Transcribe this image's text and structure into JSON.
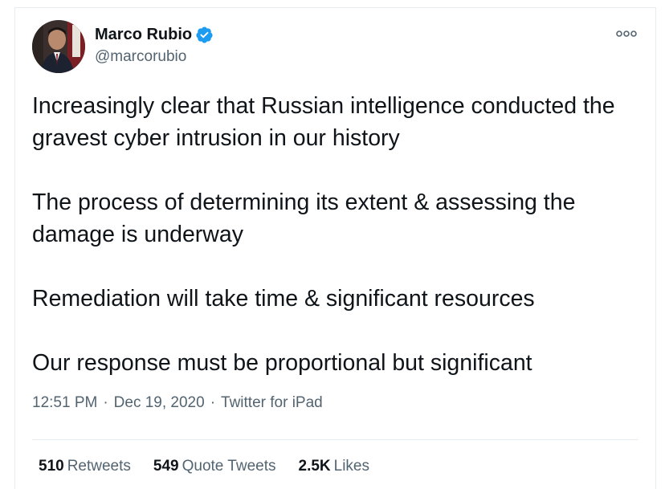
{
  "author": {
    "display_name": "Marco Rubio",
    "handle": "@marcorubio",
    "verified_icon": "verified-badge-icon",
    "avatar_icon": "avatar-photo"
  },
  "more_icon": "more-options-icon",
  "tweet": {
    "paragraphs": [
      "Increasingly clear that Russian intelligence conducted the gravest cyber intrusion in our history",
      "The process of determining its extent & assessing the damage is underway",
      "Remediation will take time & significant resources",
      "Our response must be proportional but significant"
    ]
  },
  "meta": {
    "time": "12:51 PM",
    "separator": "·",
    "date": "Dec 19, 2020",
    "source": "Twitter for iPad"
  },
  "stats": {
    "retweets_count": "510",
    "retweets_label": "Retweets",
    "quotes_count": "549",
    "quotes_label": "Quote Tweets",
    "likes_count": "2.5K",
    "likes_label": "Likes"
  },
  "colors": {
    "text": "#0f1419",
    "secondary": "#536471",
    "border": "#e6ecf0",
    "verified": "#1d9bf0"
  }
}
